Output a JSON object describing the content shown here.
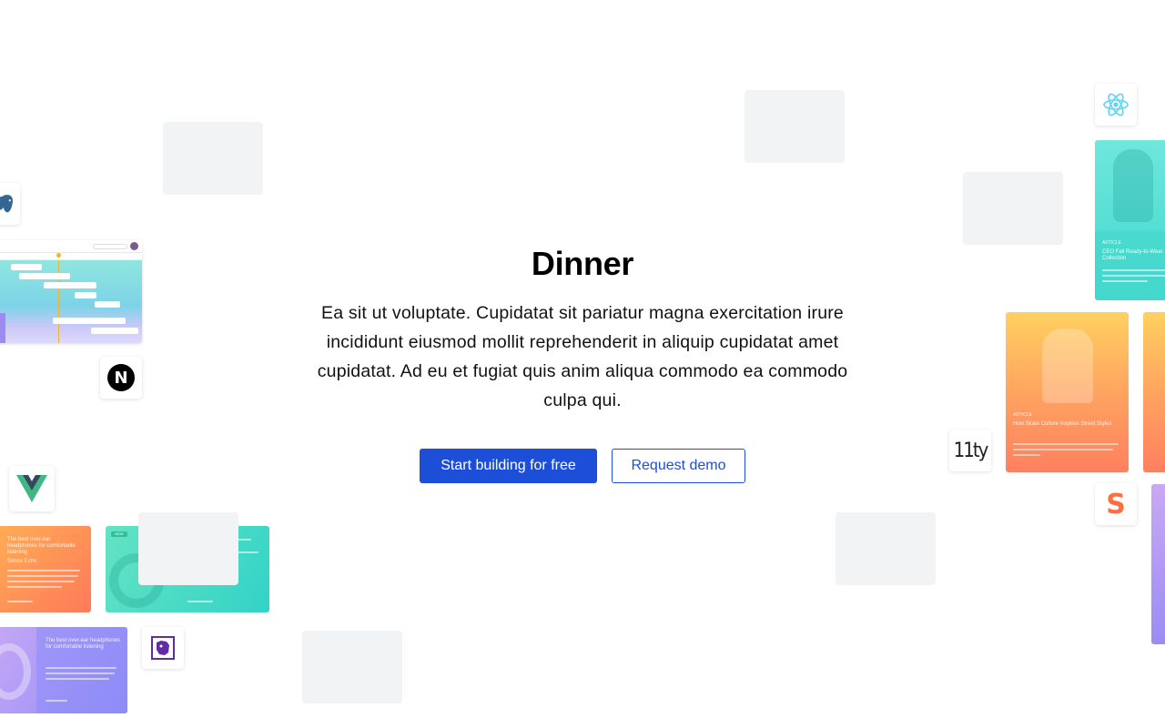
{
  "hero": {
    "title": "Dinner",
    "description": "Ea sit ut voluptate. Cupidatat sit pariatur magna exercitation irure incididunt eiusmod mollit reprehenderit in aliquip cupidatat amet cupidatat. Ad eu et fugiat quis anim aliqua commodo ea commodo culpa qui.",
    "primary_cta": "Start building for free",
    "secondary_cta": "Request demo"
  },
  "logos": {
    "react": "react-icon",
    "postgres": "postgres-icon",
    "next": "N",
    "vue": "vue-icon",
    "eleventy": "11ty",
    "svelte": "S",
    "datadog": "datadog-icon"
  },
  "cards": {
    "teal_card_tag": "ARTICLE",
    "teal_card_title": "CEO Fall Ready-to-Wear Collection",
    "orange_card_tag": "ARTICLE",
    "orange_card_title": "How Skate Culture Inspires Street Styles",
    "orange_wide_title": "The best over-ear headphones for comfortable listening",
    "orange_wide_sub": "Sonos Echo",
    "purple_wide_title": "The best over-ear headphones for comfortable listening",
    "teal_wide_badge": "NEW"
  },
  "colors": {
    "accent": "#1d4ed8",
    "placeholder": "#f2f3f5"
  }
}
